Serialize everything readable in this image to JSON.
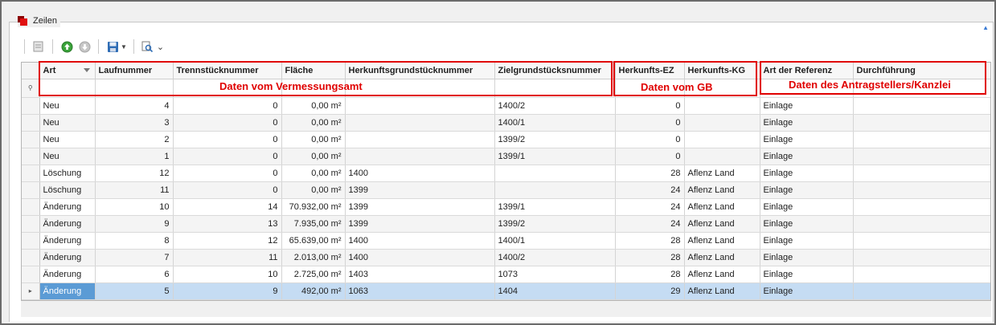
{
  "group": {
    "title": "Zeilen"
  },
  "toolbar": {
    "icons": [
      "document-icon",
      "up-icon",
      "down-icon",
      "save-icon",
      "find-icon"
    ]
  },
  "columns": [
    "Art",
    "Laufnummer",
    "Trennstücknummer",
    "Fläche",
    "Herkunftsgrundstücknummer",
    "Zielgrundstücksnummer",
    "Herkunfts-EZ",
    "Herkunfts-KG",
    "Art der Referenz",
    "Durchführung"
  ],
  "annotations": {
    "vermessungsamt": "Daten vom Vermessungsamt",
    "gb": "Daten vom GB",
    "antragsteller": "Daten des Antragstellers/Kanzlei"
  },
  "rows": [
    [
      "Neu",
      "4",
      "0",
      "0,00 m²",
      "",
      "1400/2",
      "0",
      "",
      "Einlage",
      ""
    ],
    [
      "Neu",
      "3",
      "0",
      "0,00 m²",
      "",
      "1400/1",
      "0",
      "",
      "Einlage",
      ""
    ],
    [
      "Neu",
      "2",
      "0",
      "0,00 m²",
      "",
      "1399/2",
      "0",
      "",
      "Einlage",
      ""
    ],
    [
      "Neu",
      "1",
      "0",
      "0,00 m²",
      "",
      "1399/1",
      "0",
      "",
      "Einlage",
      ""
    ],
    [
      "Löschung",
      "12",
      "0",
      "0,00 m²",
      "1400",
      "",
      "28",
      "Aflenz Land",
      "Einlage",
      ""
    ],
    [
      "Löschung",
      "11",
      "0",
      "0,00 m²",
      "1399",
      "",
      "24",
      "Aflenz Land",
      "Einlage",
      ""
    ],
    [
      "Änderung",
      "10",
      "14",
      "70.932,00 m²",
      "1399",
      "1399/1",
      "24",
      "Aflenz Land",
      "Einlage",
      ""
    ],
    [
      "Änderung",
      "9",
      "13",
      "7.935,00 m²",
      "1399",
      "1399/2",
      "24",
      "Aflenz Land",
      "Einlage",
      ""
    ],
    [
      "Änderung",
      "8",
      "12",
      "65.639,00 m²",
      "1400",
      "1400/1",
      "28",
      "Aflenz Land",
      "Einlage",
      ""
    ],
    [
      "Änderung",
      "7",
      "11",
      "2.013,00 m²",
      "1400",
      "1400/2",
      "28",
      "Aflenz Land",
      "Einlage",
      ""
    ],
    [
      "Änderung",
      "6",
      "10",
      "2.725,00 m²",
      "1403",
      "1073",
      "28",
      "Aflenz Land",
      "Einlage",
      ""
    ],
    [
      "Änderung",
      "5",
      "9",
      "492,00 m²",
      "1063",
      "1404",
      "29",
      "Aflenz Land",
      "Einlage",
      ""
    ]
  ],
  "selected_row_index": 11,
  "colors": {
    "annotation": "#e00000",
    "selection": "#c5dcf3",
    "selection_cell": "#5b9bd5"
  }
}
